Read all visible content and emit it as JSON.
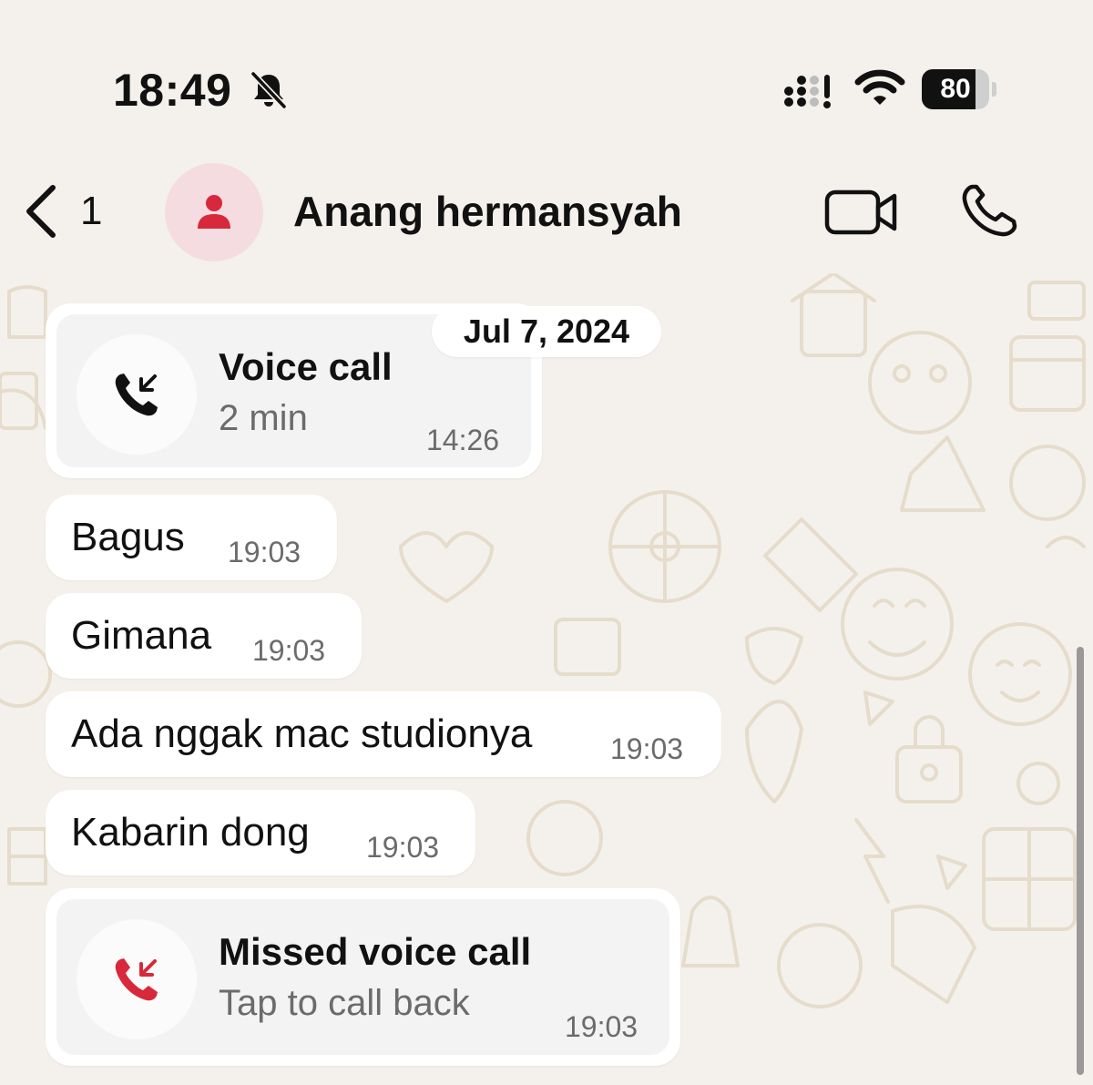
{
  "status_bar": {
    "time": "18:49",
    "battery_level": "80",
    "battery_fraction": 0.8,
    "icons": [
      "bell-slash-icon",
      "cellular-signal-icon",
      "wifi-icon",
      "battery-icon"
    ]
  },
  "header": {
    "back_count": "1",
    "contact_name": "Anang hermansyah",
    "icons": [
      "chevron-left-icon",
      "person-icon",
      "video-camera-icon",
      "phone-icon"
    ]
  },
  "date_separator": "Jul 7, 2024",
  "messages": [
    {
      "type": "call",
      "title": "Voice call",
      "subtitle": "2 min",
      "time": "14:26",
      "icon": "incoming-call-icon"
    },
    {
      "type": "text",
      "text": "Bagus",
      "time": "19:03"
    },
    {
      "type": "text",
      "text": "Gimana",
      "time": "19:03"
    },
    {
      "type": "text",
      "text": "Ada nggak mac studionya",
      "time": "19:03"
    },
    {
      "type": "text",
      "text": "Kabarin dong",
      "time": "19:03"
    },
    {
      "type": "missed_call",
      "title": "Missed voice call",
      "subtitle": "Tap to call back",
      "time": "19:03",
      "icon": "missed-call-icon"
    }
  ],
  "colors": {
    "background": "#f4f1ec",
    "bubble": "#ffffff",
    "avatar_bg": "#f5dce0",
    "accent_red": "#d8283c",
    "doodle": "#e6dccb"
  }
}
